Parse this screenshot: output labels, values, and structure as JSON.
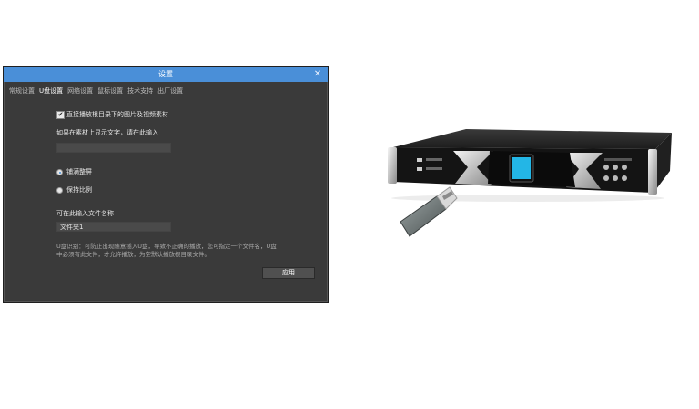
{
  "dialog": {
    "title": "设置",
    "close_glyph": "✕",
    "tabs": [
      {
        "label": "常规设置",
        "active": false
      },
      {
        "label": "U盘设置",
        "active": true
      },
      {
        "label": "网络设置",
        "active": false
      },
      {
        "label": "鼠标设置",
        "active": false
      },
      {
        "label": "技术支持",
        "active": false
      },
      {
        "label": "出厂设置",
        "active": false
      }
    ],
    "direct_play": {
      "checked": true,
      "label": "直接播放根目录下的图片及视频素材",
      "check_glyph": "✔"
    },
    "display_text": {
      "label": "如果在素材上显示文字，请在此输入",
      "value": ""
    },
    "scale_mode": {
      "options": [
        "铺满整屏",
        "保持比例"
      ],
      "selected": "铺满整屏"
    },
    "filename": {
      "label": "可在此输入文件名称",
      "value": "文件夹1"
    },
    "hint": "U盘识别：可防止出现随意插入U盘，导致不正确的播放，您可指定一个文件名，U盘中必须有此文件，才允许播放，为空默认播放根目录文件。",
    "apply_label": "应用"
  },
  "colors": {
    "accent": "#4a8fd8",
    "dialog_bg": "#3a3a3a"
  }
}
